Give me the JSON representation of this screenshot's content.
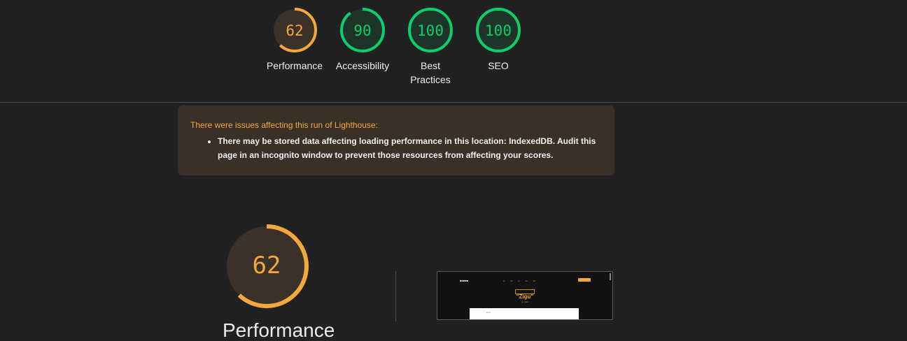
{
  "scores": [
    {
      "name": "performance",
      "value": 62,
      "label": "Performance",
      "color": "#f4a73a",
      "bg": "#3a3128"
    },
    {
      "name": "accessibility",
      "value": 90,
      "label": "Accessibility",
      "color": "#0cce6b",
      "bg": "#1e3429"
    },
    {
      "name": "best-practices",
      "value": 100,
      "label": "Best Practices",
      "color": "#0cce6b",
      "bg": "#1e3429"
    },
    {
      "name": "seo",
      "value": 100,
      "label": "SEO",
      "color": "#0cce6b",
      "bg": "#1e3429"
    }
  ],
  "warning": {
    "title": "There were issues affecting this run of Lighthouse:",
    "items": [
      "There may be stored data affecting loading performance in this location: IndexedDB. Audit this page in an incognito window to prevent those resources from affecting your scores."
    ]
  },
  "main_gauge": {
    "value": 62,
    "label": "Performance",
    "color": "#f4a73a",
    "bg": "#3a3128"
  },
  "screenshot": {
    "title": "\"Zigu\""
  }
}
